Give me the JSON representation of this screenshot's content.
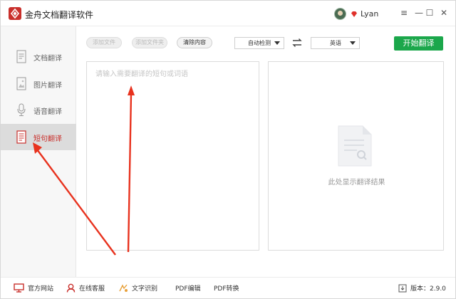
{
  "app": {
    "title": "金舟文档翻译软件",
    "user_name": "Lyan",
    "window_controls": {
      "menu": "≡",
      "minimize": "—",
      "maximize": "☐",
      "close": "✕"
    }
  },
  "sidebar": {
    "items": [
      {
        "label": "文档翻译",
        "icon": "document-icon",
        "active": false
      },
      {
        "label": "图片翻译",
        "icon": "image-icon",
        "active": false
      },
      {
        "label": "语音翻译",
        "icon": "microphone-icon",
        "active": false
      },
      {
        "label": "短句翻译",
        "icon": "text-document-icon",
        "active": true
      }
    ]
  },
  "toolbar": {
    "add_file": "添加文件",
    "add_folder": "添加文件夹",
    "clear_content": "清除内容",
    "source_lang": "自动检测",
    "target_lang": "英语",
    "start_translate": "开始翻译"
  },
  "input_panel": {
    "placeholder": "请输入需要翻译的短句或词语"
  },
  "result_panel": {
    "empty_text": "此处显示翻译结果"
  },
  "footer": {
    "official_site": "官方网站",
    "online_service": "在线客服",
    "text_recognition": "文字识别",
    "pdf_edit": "PDF编辑",
    "pdf_convert": "PDF转换",
    "version": "版本：2.9.0"
  },
  "colors": {
    "accent_red": "#c9302c",
    "start_green": "#1ba74b",
    "annotation_red": "#e8321e"
  }
}
